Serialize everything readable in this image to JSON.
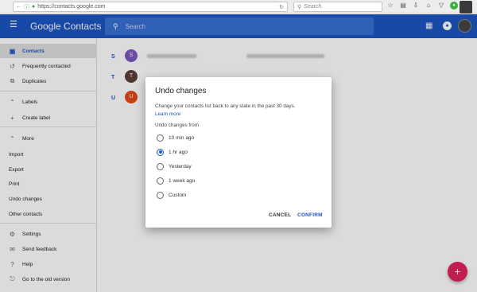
{
  "browser": {
    "url": "https://contacts.google.com",
    "search_placeholder": "Search"
  },
  "header": {
    "title": "Google Contacts",
    "search_placeholder": "Search"
  },
  "sidebar": {
    "items": [
      {
        "label": "Contacts"
      },
      {
        "label": "Frequently contacted"
      },
      {
        "label": "Duplicates"
      },
      {
        "label": "Labels"
      },
      {
        "label": "Create label"
      },
      {
        "label": "More"
      },
      {
        "label": "Import"
      },
      {
        "label": "Export"
      },
      {
        "label": "Print"
      },
      {
        "label": "Undo changes"
      },
      {
        "label": "Other contacts"
      },
      {
        "label": "Settings"
      },
      {
        "label": "Send feedback"
      },
      {
        "label": "Help"
      },
      {
        "label": "Go to the old version"
      }
    ]
  },
  "contacts": [
    {
      "letter": "S",
      "initial": "S",
      "color": "#7e57c2"
    },
    {
      "letter": "T",
      "initial": "T",
      "color": "#5d4037"
    },
    {
      "letter": "U",
      "initial": "U",
      "color": "#e64a19"
    }
  ],
  "dialog": {
    "title": "Undo changes",
    "description": "Change your contacts list back to any state in the past 30 days.",
    "learn_more": "Learn more",
    "subheading": "Undo changes from",
    "options": [
      {
        "label": "10 min ago",
        "checked": false
      },
      {
        "label": "1 hr ago",
        "checked": true
      },
      {
        "label": "Yesterday",
        "checked": false
      },
      {
        "label": "1 week ago",
        "checked": false
      },
      {
        "label": "Custom",
        "checked": false
      }
    ],
    "cancel_label": "CANCEL",
    "confirm_label": "CONFIRM"
  },
  "colors": {
    "brand": "#1e56c2",
    "fab": "#e0245e"
  }
}
